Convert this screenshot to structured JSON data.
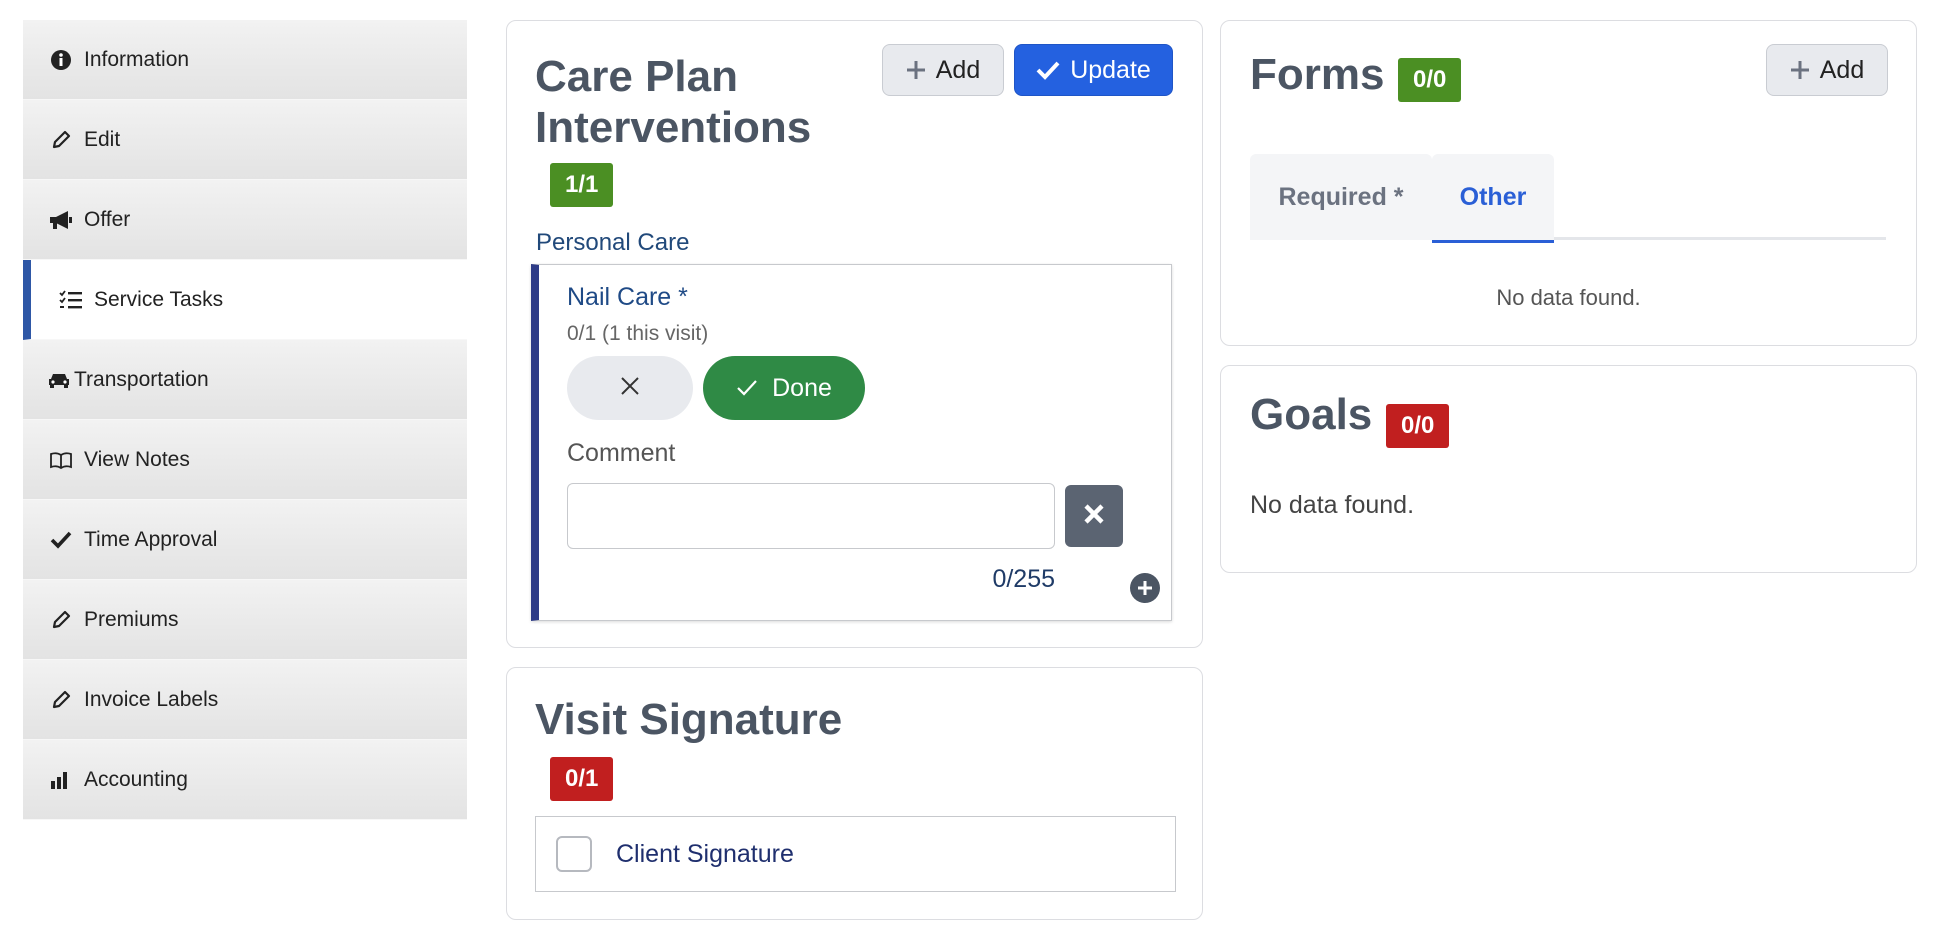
{
  "sidebar": {
    "items": [
      {
        "label": "Information",
        "icon": "info-circle-icon"
      },
      {
        "label": "Edit",
        "icon": "pencil-icon"
      },
      {
        "label": "Offer",
        "icon": "megaphone-icon"
      },
      {
        "label": "Service Tasks",
        "icon": "task-list-icon",
        "active": true
      },
      {
        "label": "Transportation",
        "icon": "car-icon"
      },
      {
        "label": "View Notes",
        "icon": "book-icon"
      },
      {
        "label": "Time Approval",
        "icon": "check-icon"
      },
      {
        "label": "Premiums",
        "icon": "pencil-icon"
      },
      {
        "label": "Invoice Labels",
        "icon": "pencil-icon"
      },
      {
        "label": "Accounting",
        "icon": "bar-chart-icon"
      }
    ]
  },
  "care_plan": {
    "title_line1": "Care Plan",
    "title_line2": "Interventions",
    "badge": "1/1",
    "add_label": "Add",
    "update_label": "Update",
    "section": "Personal Care",
    "task": {
      "title": "Nail Care *",
      "subtitle": "0/1 (1 this visit)",
      "done_label": "Done",
      "comment_label": "Comment",
      "comment_value": "",
      "counter": "0/255"
    }
  },
  "visit_signature": {
    "title": "Visit Signature",
    "badge": "0/1",
    "item_label": "Client Signature"
  },
  "forms": {
    "title": "Forms",
    "badge": "0/0",
    "add_label": "Add",
    "tabs": [
      "Required *",
      "Other"
    ],
    "active_tab": "Other",
    "empty_text": "No data found."
  },
  "goals": {
    "title": "Goals",
    "badge": "0/0",
    "empty_text": "No data found."
  },
  "colors": {
    "primary": "#2461e0",
    "success": "#2f8a45",
    "badge_green": "#4b8f23",
    "badge_red": "#c11f1f",
    "sidebar_active": "#2e57a6"
  }
}
